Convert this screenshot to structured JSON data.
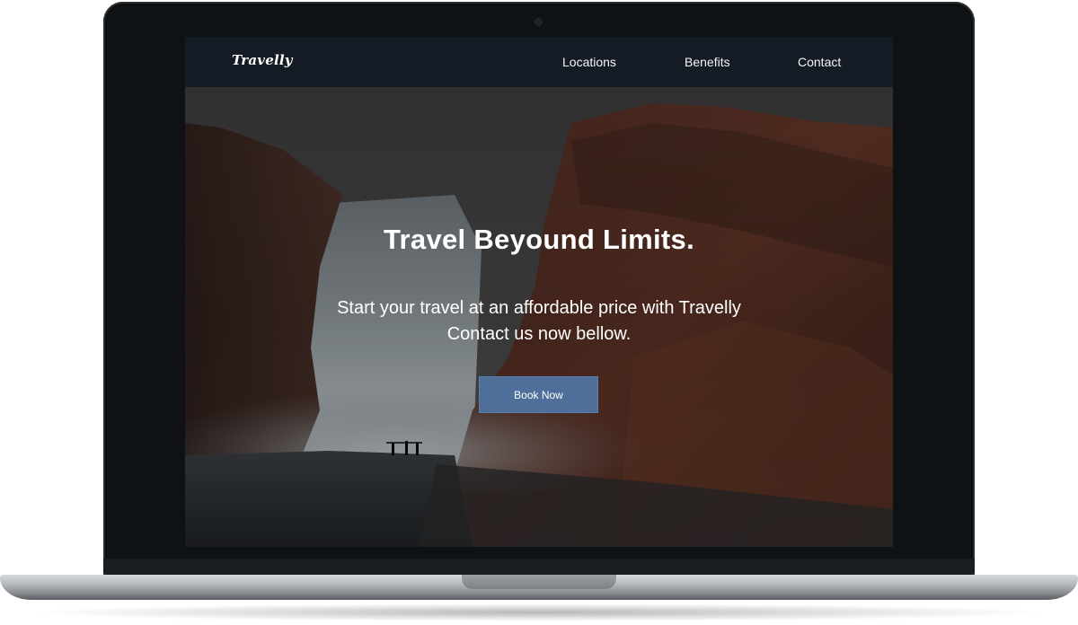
{
  "navbar": {
    "logo": "Travelly",
    "links": [
      "Locations",
      "Benefits",
      "Contact"
    ]
  },
  "hero": {
    "title": "Travel Beyound Limits.",
    "subtitle_line1": "Start your travel at an affordable price with Travelly",
    "subtitle_line2": "Contact us now bellow.",
    "cta": "Book Now"
  },
  "colors": {
    "navbar_bg": "#141b24",
    "button_bg": "#4f6e99",
    "text": "#ffffff"
  }
}
